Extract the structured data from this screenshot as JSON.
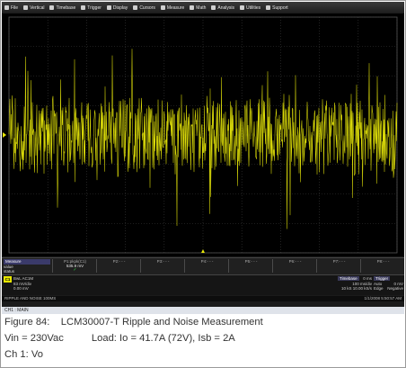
{
  "menu": [
    {
      "label": "File",
      "icon": "file-icon"
    },
    {
      "label": "Vertical",
      "icon": "vertical-icon"
    },
    {
      "label": "Timebase",
      "icon": "timebase-icon"
    },
    {
      "label": "Trigger",
      "icon": "trigger-icon"
    },
    {
      "label": "Display",
      "icon": "display-icon"
    },
    {
      "label": "Cursors",
      "icon": "cursors-icon"
    },
    {
      "label": "Measure",
      "icon": "measure-icon"
    },
    {
      "label": "Math",
      "icon": "math-icon"
    },
    {
      "label": "Analysis",
      "icon": "analysis-icon"
    },
    {
      "label": "Utilities",
      "icon": "utilities-icon"
    },
    {
      "label": "Support",
      "icon": "support-icon"
    }
  ],
  "trace_color": "#e8e80a",
  "measure": {
    "header": "Measure",
    "row1": "value",
    "row2": "status",
    "params": [
      {
        "name": "P1:pkpk(C1)",
        "value": "535.9 mV",
        "status": "✓"
      },
      {
        "name": "P2:- - -",
        "value": "",
        "status": ""
      },
      {
        "name": "P3:- - -",
        "value": "",
        "status": ""
      },
      {
        "name": "P4:- - -",
        "value": "",
        "status": ""
      },
      {
        "name": "P5:- - -",
        "value": "",
        "status": ""
      },
      {
        "name": "P6:- - -",
        "value": "",
        "status": ""
      },
      {
        "name": "P7:- - -",
        "value": "",
        "status": ""
      },
      {
        "name": "P8:- - -",
        "value": "",
        "status": ""
      }
    ]
  },
  "channel": {
    "badge": "C1",
    "line1": "BwL AC1M",
    "line2": "83 mV/div",
    "line3": "0.00 mV"
  },
  "timebase": {
    "header": "Timebase",
    "delay": "0 ms",
    "rate": "100 ms/div",
    "samples": "10 kS   10.00 kS/s"
  },
  "trigger": {
    "header": "Trigger",
    "mode": "Auto",
    "type": "Edge",
    "level": "0 mV",
    "slope": "Negative"
  },
  "status_bar": {
    "left": "RIPPLE AND NOISE 100MS",
    "right": "1/1/2008 5:50:57 AM"
  },
  "chmain": "CH1 : MAIN",
  "caption": {
    "line1": "Figure 84:    LCM30007-T Ripple and Noise Measurement",
    "line2": "Vin = 230Vac          Load: Io = 41.7A (72V), Isb = 2A",
    "line3": "Ch 1: Vo"
  }
}
